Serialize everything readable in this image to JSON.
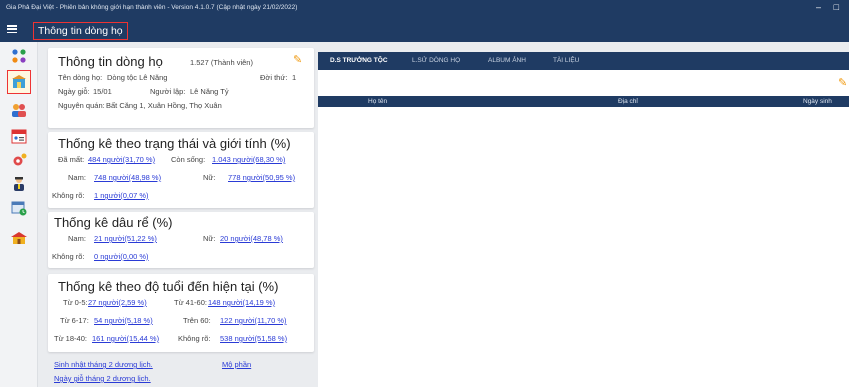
{
  "app": {
    "title": "Gia Phả Đại Việt - Phiên bản không giới hạn thành viên - Version 4.1.0.7 (Cập nhật ngày 21/02/2022)",
    "page_title": "Thông tin dòng họ"
  },
  "clan_info": {
    "title": "Thông tin dòng họ",
    "member_count": "1.527 (Thành viên)",
    "clan_name_label": "Tên dòng họ:",
    "clan_name": "Dòng tộc Lê Năng",
    "generation_label": "Đời thứ:",
    "generation": "1",
    "death_day_label": "Ngày giỗ:",
    "death_day": "15/01",
    "founder_label": "Người lập:",
    "founder": "Lê Năng Tỷ",
    "origin_label": "Nguyên quán:",
    "origin": "Bất Căng 1, Xuân Hồng, Thọ Xuân"
  },
  "status_stats": {
    "title": "Thống kê theo trạng thái và giới tính (%)",
    "deceased_label": "Đã mất:",
    "deceased": "484 người(31,70 %)",
    "alive_label": "Còn sống:",
    "alive": "1.043 người(68,30 %)",
    "male_label": "Nam:",
    "male": "748 người(48,98 %)",
    "female_label": "Nữ:",
    "female": "778 người(50,95 %)",
    "unknown_label": "Không rõ:",
    "unknown": "1 người(0,07 %)"
  },
  "inlaw_stats": {
    "title": "Thống kê dâu rể (%)",
    "male_label": "Nam:",
    "male": "21 người(51,22 %)",
    "female_label": "Nữ:",
    "female": "20 người(48,78 %)",
    "unknown_label": "Không rõ:",
    "unknown": "0 người(0,00 %)"
  },
  "age_stats": {
    "title": "Thống kê theo độ tuổi đến hiện tại (%)",
    "a0_5_label": "Từ 0-5:",
    "a0_5": "27 người(2,59 %)",
    "a41_60_label": "Từ 41-60:",
    "a41_60": "148 người(14,19 %)",
    "a6_17_label": "Từ 6-17:",
    "a6_17": "54 người(5,18 %)",
    "a60_label": "Trên 60:",
    "a60": "122 người(11,70 %)",
    "a18_40_label": "Từ 18-40:",
    "a18_40": "161 người(15,44 %)",
    "unknown_label": "Không rõ:",
    "unknown": "538 người(51,58 %)"
  },
  "links": {
    "birthday": "Sinh nhật tháng 2 dương lịch.",
    "graves": "Mộ phần",
    "deathday": "Ngày giỗ tháng 2 dương lịch."
  },
  "tabs": [
    "D.S TRƯỞNG TỘC",
    "L.SỬ DÒNG HỌ",
    "ALBUM ẢNH",
    "TÀI LIỆU"
  ],
  "table": {
    "columns": [
      "Họ tên",
      "Địa chỉ",
      "Ngày sinh"
    ]
  },
  "window_controls": {
    "minimize": "–",
    "maximize": "□"
  },
  "icons": {
    "menu": "hamburger-icon",
    "edit": "pencil-icon",
    "nav": [
      "family-tree-icon",
      "clan-info-icon",
      "members-icon",
      "calendar-icon",
      "settings-icon",
      "person-icon",
      "schedule-icon",
      "heritage-icon"
    ]
  },
  "colors": {
    "header": "#1f3b63",
    "highlight": "#e33333",
    "link": "#2a3bd6",
    "edit": "#f09a10"
  }
}
